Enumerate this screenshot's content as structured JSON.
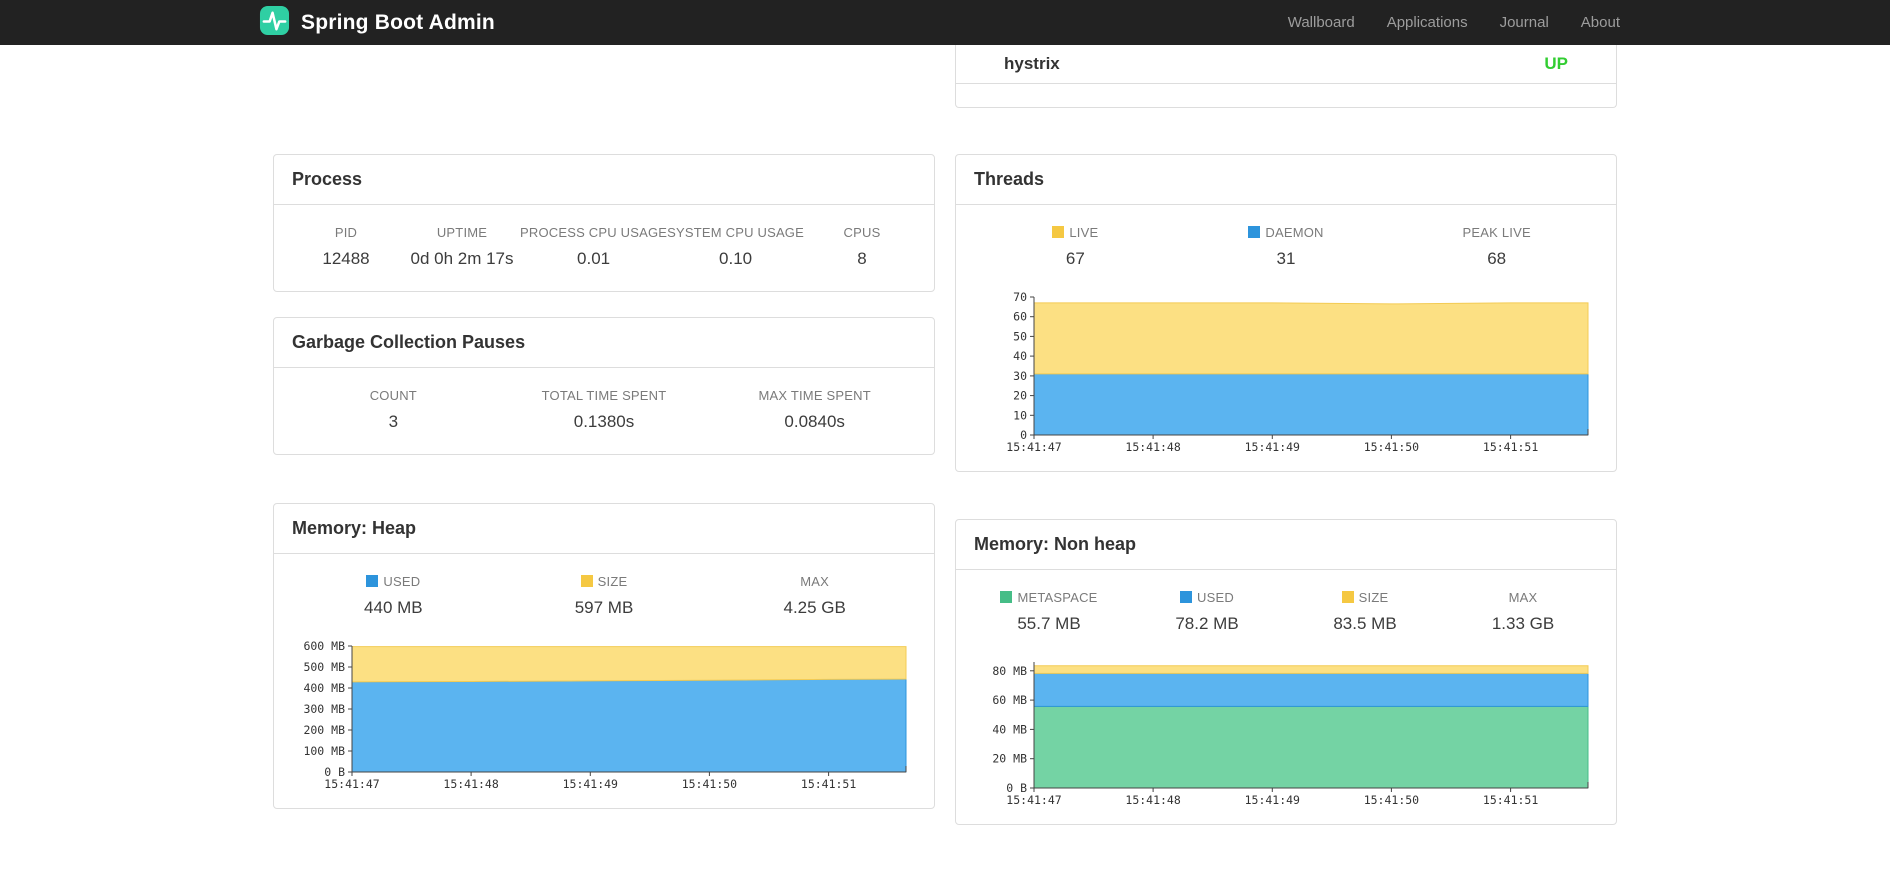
{
  "navbar": {
    "brand": "Spring Boot Admin",
    "brand_color": "#2fcfa3",
    "items": [
      {
        "label": "Wallboard"
      },
      {
        "label": "Applications"
      },
      {
        "label": "Journal"
      },
      {
        "label": "About"
      }
    ]
  },
  "application_panel": {
    "name": "hystrix",
    "status": "UP",
    "status_color": "#32CD32"
  },
  "process": {
    "title": "Process",
    "stats": [
      {
        "label": "PID",
        "value": "12488"
      },
      {
        "label": "UPTIME",
        "value": "0d 0h 2m 17s"
      },
      {
        "label": "PROCESS CPU USAGE",
        "value": "0.01"
      },
      {
        "label": "SYSTEM CPU USAGE",
        "value": "0.10"
      },
      {
        "label": "CPUS",
        "value": "8"
      }
    ]
  },
  "gc": {
    "title": "Garbage Collection Pauses",
    "stats": [
      {
        "label": "COUNT",
        "value": "3"
      },
      {
        "label": "TOTAL TIME SPENT",
        "value": "0.1380s"
      },
      {
        "label": "MAX TIME SPENT",
        "value": "0.0840s"
      }
    ]
  },
  "threads": {
    "title": "Threads",
    "stats": [
      {
        "label": "LIVE",
        "value": "67",
        "swatch": "#F5C842"
      },
      {
        "label": "DAEMON",
        "value": "31",
        "swatch": "#2D94DC"
      },
      {
        "label": "PEAK LIVE",
        "value": "68"
      }
    ]
  },
  "heap": {
    "title": "Memory: Heap",
    "stats": [
      {
        "label": "USED",
        "value": "440 MB",
        "swatch": "#2D94DC"
      },
      {
        "label": "SIZE",
        "value": "597 MB",
        "swatch": "#F5C842"
      },
      {
        "label": "MAX",
        "value": "4.25 GB"
      }
    ]
  },
  "nonheap": {
    "title": "Memory: Non heap",
    "stats": [
      {
        "label": "METASPACE",
        "value": "55.7 MB",
        "swatch": "#46BD87"
      },
      {
        "label": "USED",
        "value": "78.2 MB",
        "swatch": "#2D94DC"
      },
      {
        "label": "SIZE",
        "value": "83.5 MB",
        "swatch": "#F5C842"
      },
      {
        "label": "MAX",
        "value": "1.33 GB"
      }
    ]
  },
  "chart_data": {
    "threads": {
      "type": "area",
      "stacked": true,
      "x": [
        0,
        1,
        2,
        3,
        4,
        4.65
      ],
      "x_ticks": [
        {
          "v": 0,
          "label": "15:41:47"
        },
        {
          "v": 1,
          "label": "15:41:48"
        },
        {
          "v": 2,
          "label": "15:41:49"
        },
        {
          "v": 3,
          "label": "15:41:50"
        },
        {
          "v": 4,
          "label": "15:41:51"
        }
      ],
      "ylim": [
        0,
        70
      ],
      "y_ticks": [
        {
          "v": 0,
          "label": "0"
        },
        {
          "v": 10,
          "label": "10"
        },
        {
          "v": 20,
          "label": "20"
        },
        {
          "v": 30,
          "label": "30"
        },
        {
          "v": 40,
          "label": "40"
        },
        {
          "v": 50,
          "label": "50"
        },
        {
          "v": 60,
          "label": "60"
        },
        {
          "v": 70,
          "label": "70"
        }
      ],
      "series": [
        {
          "name": "DAEMON",
          "fill": "#5BB4F0",
          "stroke": "#2D94DC",
          "tops": [
            31,
            31,
            31,
            31,
            31,
            31
          ]
        },
        {
          "name": "LIVE",
          "fill": "#FCE083",
          "stroke": "#F3CB54",
          "tops": [
            67,
            67,
            67,
            66.5,
            67,
            67
          ]
        }
      ]
    },
    "heap": {
      "type": "area",
      "stacked": true,
      "x": [
        0,
        1,
        2,
        3,
        4,
        4.65
      ],
      "x_ticks": [
        {
          "v": 0,
          "label": "15:41:47"
        },
        {
          "v": 1,
          "label": "15:41:48"
        },
        {
          "v": 2,
          "label": "15:41:49"
        },
        {
          "v": 3,
          "label": "15:41:50"
        },
        {
          "v": 4,
          "label": "15:41:51"
        }
      ],
      "ylim": [
        0,
        600
      ],
      "y_ticks": [
        {
          "v": 0,
          "label": "0 B"
        },
        {
          "v": 100,
          "label": "100 MB"
        },
        {
          "v": 200,
          "label": "200 MB"
        },
        {
          "v": 300,
          "label": "300 MB"
        },
        {
          "v": 400,
          "label": "400 MB"
        },
        {
          "v": 500,
          "label": "500 MB"
        },
        {
          "v": 600,
          "label": "600 MB"
        }
      ],
      "series": [
        {
          "name": "USED",
          "fill": "#5BB4F0",
          "stroke": "#2D94DC",
          "tops": [
            429,
            431,
            434,
            437,
            441,
            443
          ]
        },
        {
          "name": "SIZE",
          "fill": "#FCE083",
          "stroke": "#F3CB54",
          "tops": [
            597,
            597,
            597,
            597,
            597,
            597
          ]
        }
      ]
    },
    "nonheap": {
      "type": "area",
      "stacked": true,
      "x": [
        0,
        1,
        2,
        3,
        4,
        4.65
      ],
      "x_ticks": [
        {
          "v": 0,
          "label": "15:41:47"
        },
        {
          "v": 1,
          "label": "15:41:48"
        },
        {
          "v": 2,
          "label": "15:41:49"
        },
        {
          "v": 3,
          "label": "15:41:50"
        },
        {
          "v": 4,
          "label": "15:41:51"
        }
      ],
      "ylim": [
        0,
        86
      ],
      "y_ticks": [
        {
          "v": 0,
          "label": "0 B"
        },
        {
          "v": 20,
          "label": "20 MB"
        },
        {
          "v": 40,
          "label": "40 MB"
        },
        {
          "v": 60,
          "label": "60 MB"
        },
        {
          "v": 80,
          "label": "80 MB"
        }
      ],
      "series": [
        {
          "name": "METASPACE",
          "fill": "#74D3A4",
          "stroke": "#46BD87",
          "tops": [
            55.7,
            55.7,
            55.7,
            55.7,
            55.7,
            55.7
          ]
        },
        {
          "name": "USED",
          "fill": "#5BB4F0",
          "stroke": "#2D94DC",
          "tops": [
            78.2,
            78.2,
            78.2,
            78.2,
            78.2,
            78.2
          ]
        },
        {
          "name": "SIZE",
          "fill": "#FCE083",
          "stroke": "#F3CB54",
          "tops": [
            83.4,
            83.4,
            83.5,
            83.5,
            83.5,
            83.5
          ]
        }
      ]
    }
  }
}
